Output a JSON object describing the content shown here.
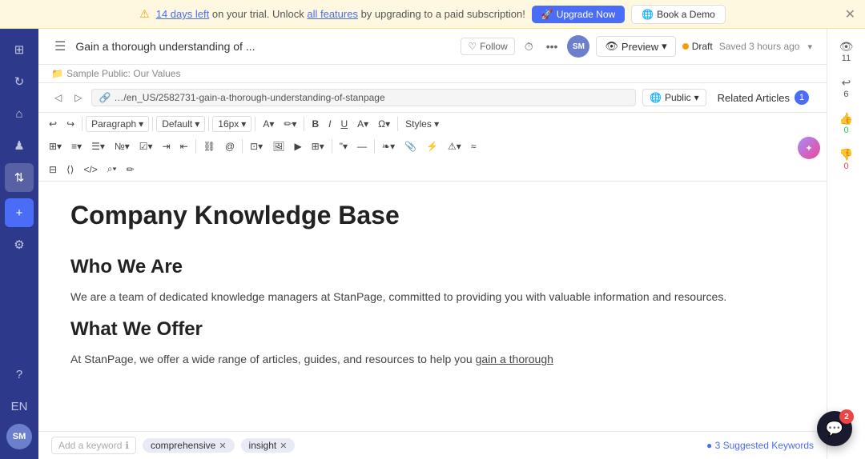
{
  "banner": {
    "trial_text": "14 days left",
    "on_trial_text": " on your trial. Unlock ",
    "all_features": "all features",
    "upgrade_suffix": " by upgrading to a paid subscription!",
    "upgrade_btn": "Upgrade Now",
    "demo_btn": "Book a Demo"
  },
  "sidebar": {
    "items": [
      {
        "icon": "⊞",
        "name": "grid-icon"
      },
      {
        "icon": "↻",
        "name": "refresh-icon"
      },
      {
        "icon": "⌂",
        "name": "home-icon"
      },
      {
        "icon": "♟",
        "name": "puzzle-icon"
      },
      {
        "icon": "↕",
        "name": "sync-icon"
      },
      {
        "icon": "☁",
        "name": "cloud-icon"
      },
      {
        "icon": "?",
        "name": "help-icon"
      },
      {
        "icon": "◎",
        "name": "settings-icon"
      }
    ],
    "add_icon": "+",
    "avatar": "SM"
  },
  "header": {
    "title": "Gain a thorough understanding of ...",
    "follow_label": "Follow",
    "preview_label": "Preview",
    "status": "Draft",
    "saved": "Saved 3 hours ago",
    "avatar": "SM"
  },
  "breadcrumb": {
    "folder_icon": "📁",
    "path": "Sample Public: Our Values"
  },
  "url_bar": {
    "back_icon": "◁",
    "forward_icon": "▷",
    "link_icon": "🔗",
    "url": "…/en_US/2582731-gain-a-thorough-understanding-of-stanpage",
    "public_label": "Public",
    "globe_icon": "🌐",
    "related_articles": "Related Articles",
    "related_count": "1"
  },
  "toolbar": {
    "row1": [
      {
        "label": "↩",
        "name": "undo"
      },
      {
        "label": "↪",
        "name": "redo"
      },
      {
        "label": "Paragraph ▾",
        "name": "paragraph-select"
      },
      {
        "label": "Default ▾",
        "name": "style-select"
      },
      {
        "label": "16px ▾",
        "name": "size-select"
      },
      {
        "label": "A▾",
        "name": "font-color"
      },
      {
        "label": "✏▾",
        "name": "highlight"
      },
      {
        "label": "B",
        "name": "bold",
        "bold": true
      },
      {
        "label": "I",
        "name": "italic"
      },
      {
        "label": "U",
        "name": "underline"
      },
      {
        "label": "A▾",
        "name": "text-color"
      },
      {
        "label": "Ω▾",
        "name": "special-char"
      },
      {
        "label": "Styles ▾",
        "name": "styles-menu"
      }
    ],
    "row2": [
      {
        "label": "⊞▾",
        "name": "indent"
      },
      {
        "label": "≡▾",
        "name": "align"
      },
      {
        "label": "☰▾",
        "name": "list-ul"
      },
      {
        "label": "№▾",
        "name": "list-ol"
      },
      {
        "label": "❐▾",
        "name": "checklist"
      },
      {
        "label": "⇥",
        "name": "indent-right"
      },
      {
        "label": "⇤",
        "name": "outdent"
      },
      {
        "label": "⛓",
        "name": "link"
      },
      {
        "label": "@",
        "name": "mention"
      },
      {
        "label": "⊡▾",
        "name": "table"
      },
      {
        "label": "🖼",
        "name": "image"
      },
      {
        "label": "▶",
        "name": "video"
      },
      {
        "label": "⊞▾",
        "name": "embed"
      },
      {
        "label": "\"▾",
        "name": "quote"
      },
      {
        "label": "—",
        "name": "divider"
      },
      {
        "label": "❧▾",
        "name": "emoji"
      },
      {
        "label": "☊",
        "name": "attachment"
      },
      {
        "label": "⚡",
        "name": "shortcut"
      },
      {
        "label": "⚠▾",
        "name": "alert"
      },
      {
        "label": "≈",
        "name": "more-formats"
      }
    ],
    "row3": [
      {
        "label": "⊟",
        "name": "collapse"
      },
      {
        "label": "⟨⟩",
        "name": "arrows"
      },
      {
        "label": "</>",
        "name": "code"
      },
      {
        "label": "⌕▾",
        "name": "search"
      },
      {
        "label": "✏",
        "name": "pencil"
      }
    ]
  },
  "editor": {
    "title": "Company Knowledge Base",
    "section1_heading": "Who We Are",
    "section1_body": "We are a team of dedicated knowledge managers at StanPage, committed to providing you with valuable information and resources.",
    "section2_heading": "What We Offer",
    "section2_body": "At StanPage, we offer a wide range of articles, guides, and resources to help you gain a thorough"
  },
  "keywords": {
    "placeholder": "Add a keyword",
    "tags": [
      {
        "label": "comprehensive"
      },
      {
        "label": "insight"
      }
    ],
    "suggested_btn": "● 3 Suggested Keywords"
  },
  "right_panel": {
    "stats": [
      {
        "icon": "👁",
        "count": "11",
        "name": "views"
      },
      {
        "icon": "↩",
        "count": "6",
        "name": "reactions"
      },
      {
        "icon": "👍",
        "count": "0",
        "name": "likes"
      },
      {
        "icon": "👎",
        "count": "0",
        "name": "dislikes"
      }
    ]
  },
  "chat": {
    "icon": "💬",
    "badge": "2"
  }
}
